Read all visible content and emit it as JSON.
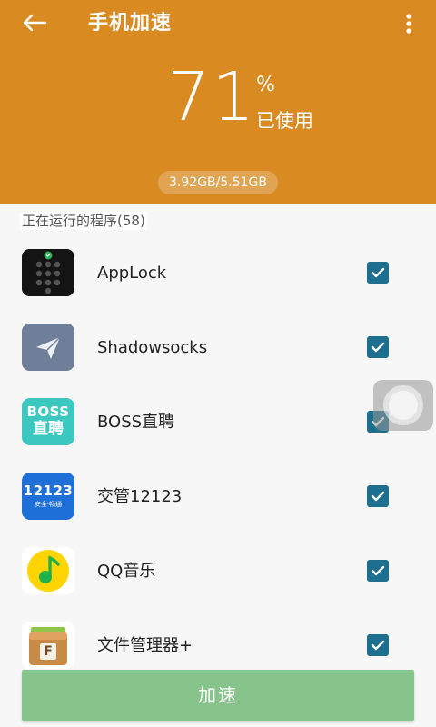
{
  "header": {
    "title": "手机加速",
    "back_icon": "arrow-left-icon",
    "more_icon": "more-vertical-icon",
    "background_color": "#d98b22"
  },
  "memory": {
    "percent": "71",
    "percent_sign": "%",
    "used_label": "已使用",
    "usage_text": "3.92GB/5.51GB"
  },
  "list": {
    "section_title": "正在运行的程序(58)",
    "apps": [
      {
        "name": "AppLock",
        "icon": "applock-icon",
        "checked": true
      },
      {
        "name": "Shadowsocks",
        "icon": "shadowsocks-icon",
        "checked": true
      },
      {
        "name": "BOSS直聘",
        "icon": "boss-zhipin-icon",
        "checked": true,
        "icon_text_top": "BOSS",
        "icon_text_bottom": "直聘"
      },
      {
        "name": "交管12123",
        "icon": "jiaoguan-12123-icon",
        "checked": true,
        "icon_text_top": "12123",
        "icon_text_bottom": "安全·畅通"
      },
      {
        "name": "QQ音乐",
        "icon": "qq-music-icon",
        "checked": true
      },
      {
        "name": "文件管理器+",
        "icon": "file-manager-icon",
        "checked": true,
        "icon_text": "F"
      }
    ]
  },
  "action": {
    "accelerate_label": "加速",
    "button_color": "#86c48c"
  },
  "checkbox_color": "#1d6f8f",
  "floating_ball_icon": "floating-ball-icon"
}
